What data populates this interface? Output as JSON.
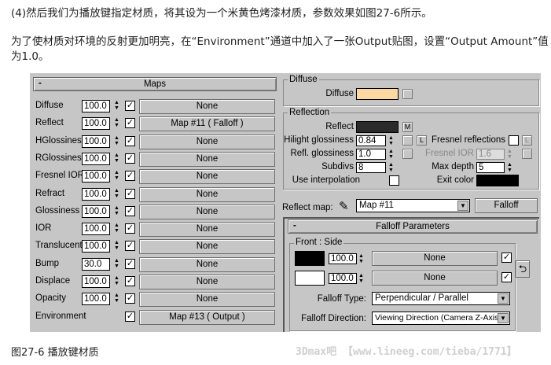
{
  "article": {
    "para1": "(4)然后我们为播放键指定材质，将其设为一个米黄色烤漆材质，参数效果如图27-6所示。",
    "para2": "为了使材质对环境的反射更加明亮，在“Environment”通道中加入了一张Output贴图，设置“Output Amount”值为1.0。",
    "caption": "图27-6 播放键材质",
    "watermark": "3Dmax吧 【www.lineeg.com/tieba/1771】"
  },
  "maps": {
    "minus": "-",
    "title": "Maps",
    "rows": [
      {
        "label": "Diffuse",
        "amount": "100.0",
        "checked": true,
        "map": "None"
      },
      {
        "label": "Reflect",
        "amount": "100.0",
        "checked": true,
        "map": "Map #11  ( Falloff )"
      },
      {
        "label": "HGlossiness",
        "amount": "100.0",
        "checked": true,
        "map": "None"
      },
      {
        "label": "RGlossiness",
        "amount": "100.0",
        "checked": true,
        "map": "None"
      },
      {
        "label": "Fresnel IOR",
        "amount": "100.0",
        "checked": true,
        "map": "None"
      },
      {
        "label": "Refract",
        "amount": "100.0",
        "checked": true,
        "map": "None"
      },
      {
        "label": "Glossiness",
        "amount": "100.0",
        "checked": true,
        "map": "None"
      },
      {
        "label": "IOR",
        "amount": "100.0",
        "checked": true,
        "map": "None"
      },
      {
        "label": "Translucent",
        "amount": "100.0",
        "checked": true,
        "map": "None"
      },
      {
        "label": "Bump",
        "amount": "30.0",
        "checked": true,
        "map": "None"
      },
      {
        "label": "Displace",
        "amount": "100.0",
        "checked": true,
        "map": "None"
      },
      {
        "label": "Opacity",
        "amount": "100.0",
        "checked": true,
        "map": "None"
      },
      {
        "label": "Environment",
        "amount": "",
        "checked": true,
        "map": "Map #13  ( Output )"
      }
    ]
  },
  "diffuse": {
    "group": "Diffuse",
    "label": "Diffuse",
    "color": "#fcd9a3"
  },
  "reflection": {
    "group": "Reflection",
    "reflect_label": "Reflect",
    "reflect_color": "#2a2a2a",
    "reflect_map_btn": "M",
    "hilight_label": "Hilight glossiness",
    "hilight_value": "0.84",
    "lock_btn": "L",
    "refl_gloss_label": "Refl. glossiness",
    "refl_gloss_value": "1.0",
    "subdivs_label": "Subdivs",
    "subdivs_value": "8",
    "interp_label": "Use interpolation",
    "fresnel_label": "Fresnel reflections",
    "fresnel_lock": "L",
    "fresnel_ior_label": "Fresnel IOR",
    "fresnel_ior_value": "1.6",
    "max_depth_label": "Max depth",
    "max_depth_value": "5",
    "exit_label": "Exit color",
    "exit_color": "#000000"
  },
  "reflect_map": {
    "label": "Reflect map:",
    "value": "Map #11",
    "button": "Falloff"
  },
  "falloff": {
    "minus": "-",
    "title": "Falloff Parameters",
    "front_side": "Front : Side",
    "rows": [
      {
        "color": "#000000",
        "amount": "100.0",
        "map": "None"
      },
      {
        "color": "#ffffff",
        "amount": "100.0",
        "map": "None"
      }
    ],
    "type_label": "Falloff Type:",
    "type_value": "Perpendicular / Parallel",
    "dir_label": "Falloff Direction:",
    "dir_value": "Viewing Direction (Camera Z-Axis)"
  }
}
